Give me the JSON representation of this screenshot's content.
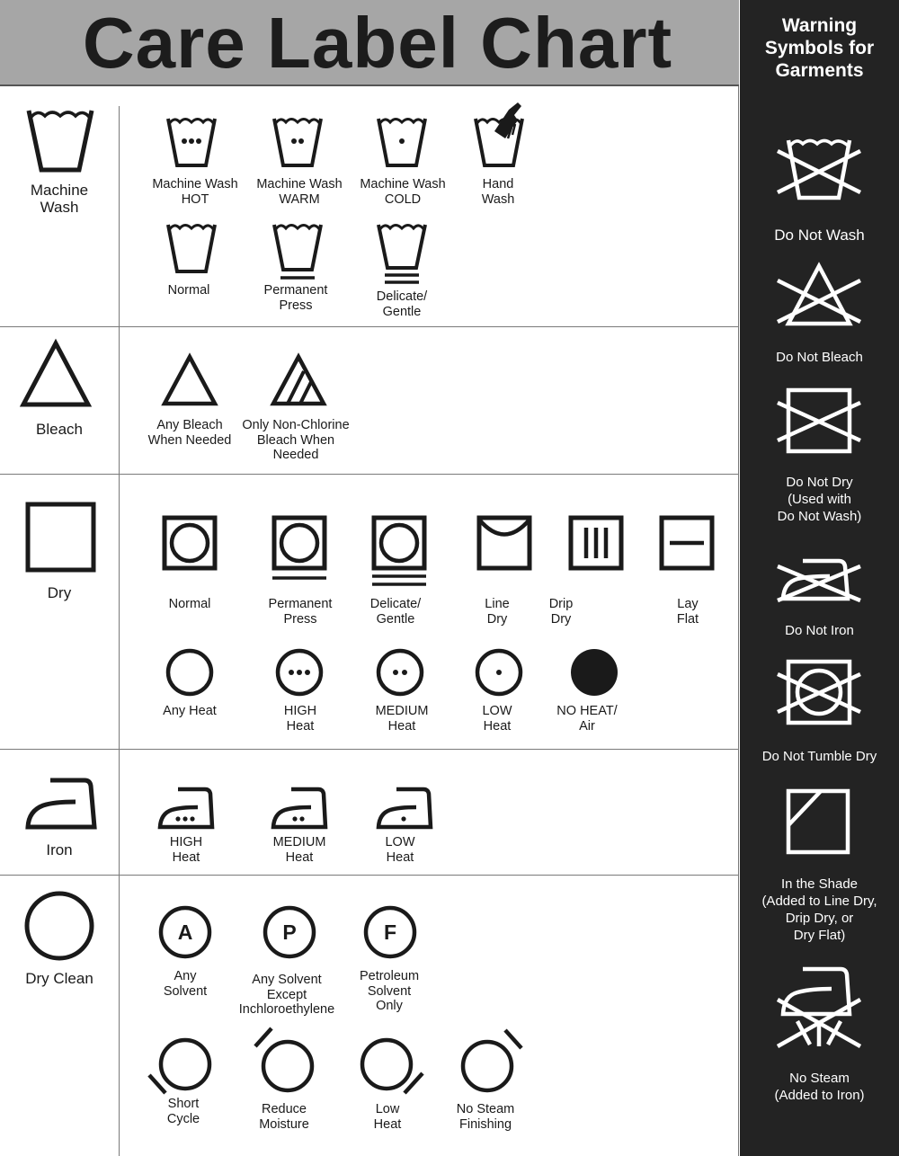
{
  "title": "Care Label Chart",
  "categories": {
    "wash": "Machine\nWash",
    "bleach": "Bleach",
    "dry": "Dry",
    "iron": "Iron",
    "dryclean": "Dry Clean"
  },
  "wash": [
    "Machine Wash\nHOT",
    "Machine Wash\nWARM",
    "Machine Wash\nCOLD",
    "Hand\nWash",
    "Normal",
    "Permanent\nPress",
    "Delicate/\nGentle"
  ],
  "bleach": [
    "Any Bleach\nWhen Needed",
    "Only Non-Chlorine\nBleach When\nNeeded"
  ],
  "dry": [
    "Normal",
    "Permanent\nPress",
    "Delicate/\nGentle",
    "Line\nDry",
    "Drip\nDry",
    "Lay\nFlat",
    "Any Heat",
    "HIGH\nHeat",
    "MEDIUM\nHeat",
    "LOW\nHeat",
    "NO HEAT/\nAir"
  ],
  "iron": [
    "HIGH\nHeat",
    "MEDIUM\nHeat",
    "LOW\nHeat"
  ],
  "dryclean": [
    "Any\nSolvent",
    "Any Solvent\nExcept\nInchloroethylene",
    "Petroleum\nSolvent\nOnly",
    "Short\nCycle",
    "Reduce\nMoisture",
    "Low\nHeat",
    "No Steam\nFinishing"
  ],
  "dryclean_letters": [
    "A",
    "P",
    "F"
  ],
  "warning": {
    "title": "Warning\nSymbols for\nGarments",
    "items": [
      "Do Not Wash",
      "Do Not Bleach",
      "Do Not Dry\n(Used with\nDo Not Wash)",
      "Do Not Iron",
      "Do Not Tumble Dry",
      "In the Shade\n(Added to Line Dry,\nDrip Dry, or\nDry Flat)",
      "No Steam\n(Added to Iron)"
    ]
  },
  "colors": {
    "title_bg": "#a6a6a6",
    "sidebar_bg": "#232323",
    "ink": "#1a1a1a"
  }
}
